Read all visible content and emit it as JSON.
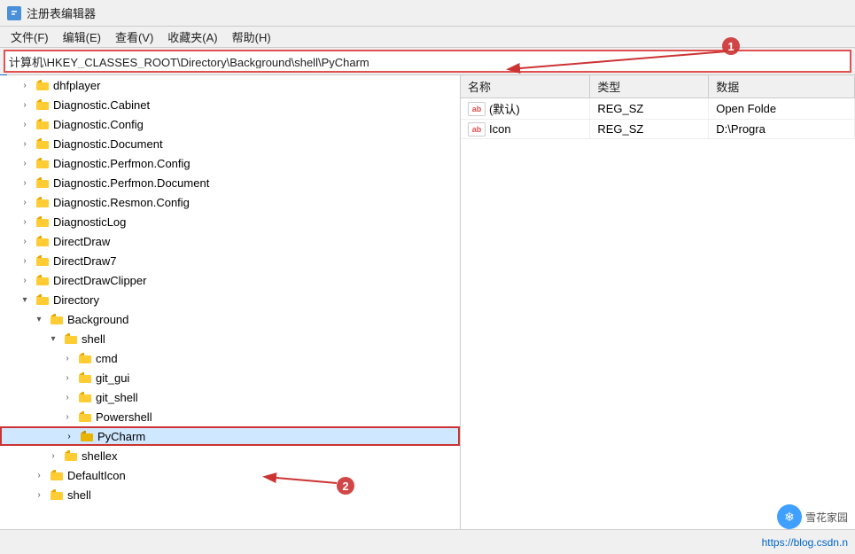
{
  "window": {
    "title": "注册表编辑器",
    "title_icon": "registry-icon"
  },
  "menu": {
    "items": [
      "文件(F)",
      "编辑(E)",
      "查看(V)",
      "收藏夹(A)",
      "帮助(H)"
    ]
  },
  "address_bar": {
    "value": "计算机\\HKEY_CLASSES_ROOT\\Directory\\Background\\shell\\PyCharm",
    "placeholder": ""
  },
  "tree": {
    "items": [
      {
        "id": "dhfplayer",
        "label": "dhfplayer",
        "indent": 1,
        "expanded": false,
        "type": "folder"
      },
      {
        "id": "diagnostic-cabinet",
        "label": "Diagnostic.Cabinet",
        "indent": 1,
        "expanded": false,
        "type": "folder"
      },
      {
        "id": "diagnostic-config",
        "label": "Diagnostic.Config",
        "indent": 1,
        "expanded": false,
        "type": "folder"
      },
      {
        "id": "diagnostic-document",
        "label": "Diagnostic.Document",
        "indent": 1,
        "expanded": false,
        "type": "folder"
      },
      {
        "id": "diagnostic-perfmon-config",
        "label": "Diagnostic.Perfmon.Config",
        "indent": 1,
        "expanded": false,
        "type": "folder"
      },
      {
        "id": "diagnostic-perfmon-document",
        "label": "Diagnostic.Perfmon.Document",
        "indent": 1,
        "expanded": false,
        "type": "folder"
      },
      {
        "id": "diagnostic-resmon-config",
        "label": "Diagnostic.Resmon.Config",
        "indent": 1,
        "expanded": false,
        "type": "folder"
      },
      {
        "id": "diagnosticlog",
        "label": "DiagnosticLog",
        "indent": 1,
        "expanded": false,
        "type": "folder"
      },
      {
        "id": "directdraw",
        "label": "DirectDraw",
        "indent": 1,
        "expanded": false,
        "type": "folder"
      },
      {
        "id": "directdraw7",
        "label": "DirectDraw7",
        "indent": 1,
        "expanded": false,
        "type": "folder"
      },
      {
        "id": "directdrawclipper",
        "label": "DirectDrawClipper",
        "indent": 1,
        "expanded": false,
        "type": "folder"
      },
      {
        "id": "directory",
        "label": "Directory",
        "indent": 1,
        "expanded": true,
        "type": "folder"
      },
      {
        "id": "background",
        "label": "Background",
        "indent": 2,
        "expanded": true,
        "type": "folder"
      },
      {
        "id": "shell",
        "label": "shell",
        "indent": 3,
        "expanded": true,
        "type": "folder"
      },
      {
        "id": "cmd",
        "label": "cmd",
        "indent": 4,
        "expanded": false,
        "type": "folder"
      },
      {
        "id": "git-gui",
        "label": "git_gui",
        "indent": 4,
        "expanded": false,
        "type": "folder"
      },
      {
        "id": "git-shell",
        "label": "git_shell",
        "indent": 4,
        "expanded": false,
        "type": "folder"
      },
      {
        "id": "powershell",
        "label": "Powershell",
        "indent": 4,
        "expanded": false,
        "type": "folder"
      },
      {
        "id": "pycharm",
        "label": "PyCharm",
        "indent": 4,
        "expanded": false,
        "type": "folder",
        "selected": true,
        "highlight": true
      },
      {
        "id": "shellex",
        "label": "shellex",
        "indent": 3,
        "expanded": false,
        "type": "folder"
      },
      {
        "id": "defaulticon",
        "label": "DefaultIcon",
        "indent": 2,
        "expanded": false,
        "type": "folder"
      },
      {
        "id": "shell2",
        "label": "shell",
        "indent": 2,
        "expanded": false,
        "type": "folder"
      }
    ]
  },
  "values_panel": {
    "columns": [
      "名称",
      "类型",
      "数据"
    ],
    "rows": [
      {
        "name": "(默认)",
        "type": "REG_SZ",
        "data": "Open Folde",
        "icon": "ab"
      },
      {
        "name": "Icon",
        "type": "REG_SZ",
        "data": "D:\\Progra",
        "icon": "ab"
      }
    ]
  },
  "annotations": {
    "arrow1_label": "1",
    "arrow2_label": "2"
  },
  "status_bar": {
    "url": "https://blog.csdn.n",
    "watermark_text": "雪花家园",
    "watermark_icon": "❄"
  }
}
